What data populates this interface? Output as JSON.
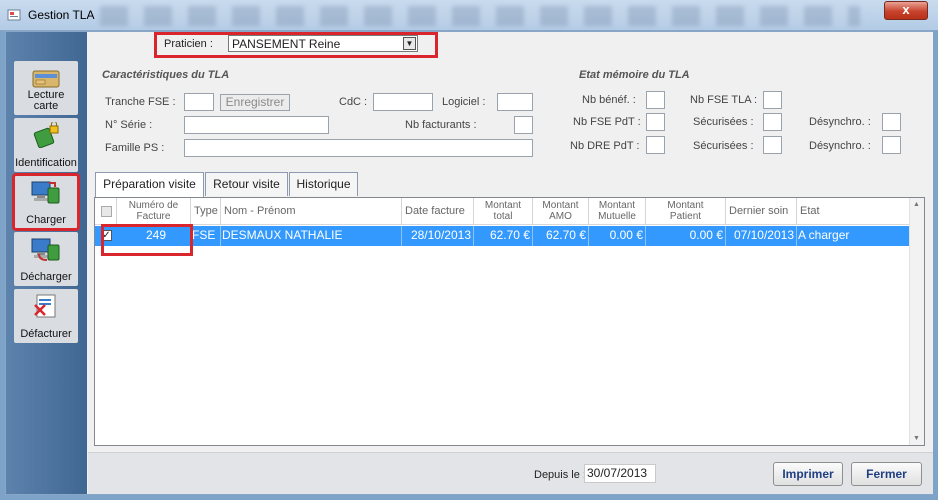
{
  "window": {
    "title": "Gestion TLA",
    "close_glyph": "x"
  },
  "toolbar": {
    "items": [
      {
        "id": "lecture",
        "label_line1": "Lecture",
        "label_line2": "carte",
        "icon": "card-reader-icon"
      },
      {
        "id": "identification",
        "label": "Identification",
        "icon": "lock-card-icon"
      },
      {
        "id": "charger",
        "label": "Charger",
        "icon": "computer-load-icon"
      },
      {
        "id": "decharger",
        "label": "Décharger",
        "icon": "computer-unload-icon"
      },
      {
        "id": "defacturer",
        "label": "Défacturer",
        "icon": "cancel-invoice-icon"
      }
    ]
  },
  "praticien": {
    "label": "Praticien :",
    "value": "PANSEMENT Reine"
  },
  "caracteristiques": {
    "title": "Caractéristiques du TLA",
    "tranche_fse_label": "Tranche FSE :",
    "enregistrer_label": "Enregistrer",
    "cdc_label": "CdC :",
    "logiciel_label": "Logiciel :",
    "serie_label": "N° Série :",
    "nb_facturants_label": "Nb facturants :",
    "famille_ps_label": "Famille PS :"
  },
  "etat_memoire": {
    "title": "Etat mémoire du TLA",
    "nb_benef_label": "Nb bénéf. :",
    "nb_fse_tla_label": "Nb FSE TLA :",
    "nb_fse_pdt_label": "Nb FSE PdT :",
    "securisees_label": "Sécurisées :",
    "desynchro_label": "Désynchro. :",
    "nb_dre_pdt_label": "Nb DRE PdT :"
  },
  "tabs": [
    {
      "label": "Préparation visite",
      "active": true
    },
    {
      "label": "Retour visite",
      "active": false
    },
    {
      "label": "Historique",
      "active": false
    }
  ],
  "table": {
    "columns": {
      "numero": "Numéro de Facture",
      "type": "Type",
      "nom": "Nom - Prénom",
      "date": "Date facture",
      "total": "Montant total",
      "amo": "Montant AMO",
      "mutuelle": "Montant Mutuelle",
      "patient": "Montant Patient",
      "dernier": "Dernier soin",
      "etat": "Etat"
    },
    "rows": [
      {
        "checked": true,
        "numero": "249",
        "type": "FSE",
        "nom": "DESMAUX NATHALIE",
        "date": "28/10/2013",
        "total": "62.70 €",
        "amo": "62.70 €",
        "mutuelle": "0.00 €",
        "patient": "0.00 €",
        "dernier": "07/10/2013",
        "etat": "A charger"
      }
    ]
  },
  "footer": {
    "depuis_label": "Depuis le :",
    "depuis_value": "30/07/2013",
    "imprimer_label": "Imprimer",
    "fermer_label": "Fermer"
  },
  "colors": {
    "selection": "#3399ff",
    "highlight": "#d9262c",
    "button_text": "#1f3f82"
  }
}
